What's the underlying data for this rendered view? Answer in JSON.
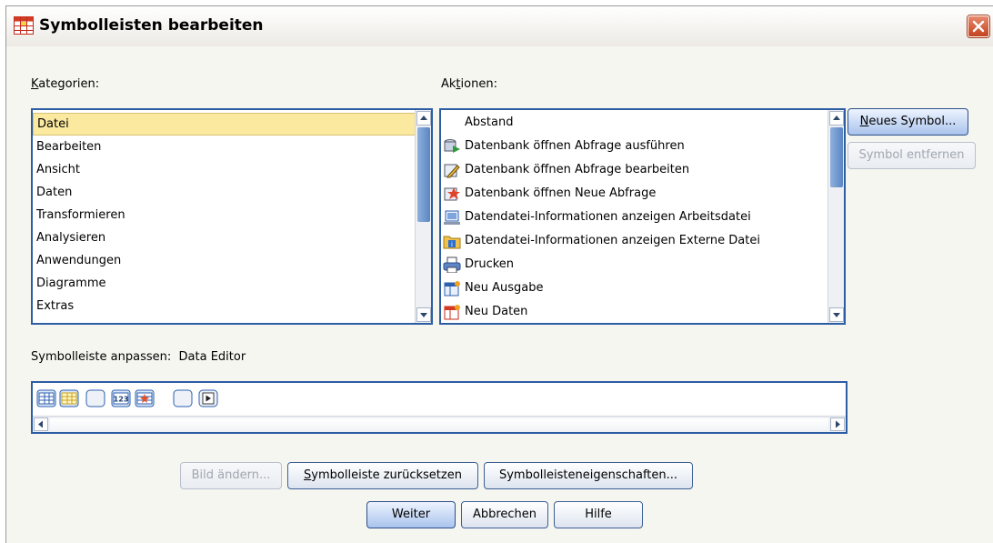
{
  "window": {
    "title": "Symbolleisten bearbeiten"
  },
  "categories": {
    "label": "Kategorien:",
    "label_underline": "K",
    "items": [
      "Datei",
      "Bearbeiten",
      "Ansicht",
      "Daten",
      "Transformieren",
      "Analysieren",
      "Anwendungen",
      "Diagramme",
      "Extras"
    ],
    "selected": "Datei"
  },
  "actions": {
    "label": "Aktionen:",
    "items": [
      {
        "label": "Abstand",
        "icon": "blank-icon"
      },
      {
        "label": "Datenbank öffnen Abfrage ausführen",
        "icon": "database-run-query-icon"
      },
      {
        "label": "Datenbank öffnen Abfrage bearbeiten",
        "icon": "database-edit-query-icon"
      },
      {
        "label": "Datenbank öffnen Neue Abfrage",
        "icon": "database-new-query-icon"
      },
      {
        "label": "Datendatei-Informationen anzeigen Arbeitsdatei",
        "icon": "file-info-working-icon"
      },
      {
        "label": "Datendatei-Informationen anzeigen Externe Datei",
        "icon": "file-info-external-icon"
      },
      {
        "label": "Drucken",
        "icon": "print-icon"
      },
      {
        "label": "Neu Ausgabe",
        "icon": "new-output-icon"
      },
      {
        "label": "Neu Daten",
        "icon": "new-data-icon"
      }
    ],
    "selected": "Abstand"
  },
  "buttons": {
    "new_symbol": "Neues Symbol...",
    "remove_symbol": "Symbol entfernen",
    "change_image": "Bild ändern...",
    "reset_toolbar": "Symbolleiste zurücksetzen",
    "toolbar_properties": "Symbolleisteneigenschaften...",
    "continue": "Weiter",
    "cancel": "Abbrechen",
    "help": "Hilfe"
  },
  "customize": {
    "label": "Symbolleiste anpassen:",
    "value": "Data Editor",
    "icons": [
      "data-view-icon",
      "variable-view-icon",
      "blank-icon",
      "numeric-123-icon",
      "chart-icon",
      "blank-icon",
      "play-icon"
    ]
  },
  "colors": {
    "accent_border": "#2d5da3",
    "selection": "#fbe9a0",
    "close": "#c4431f"
  }
}
